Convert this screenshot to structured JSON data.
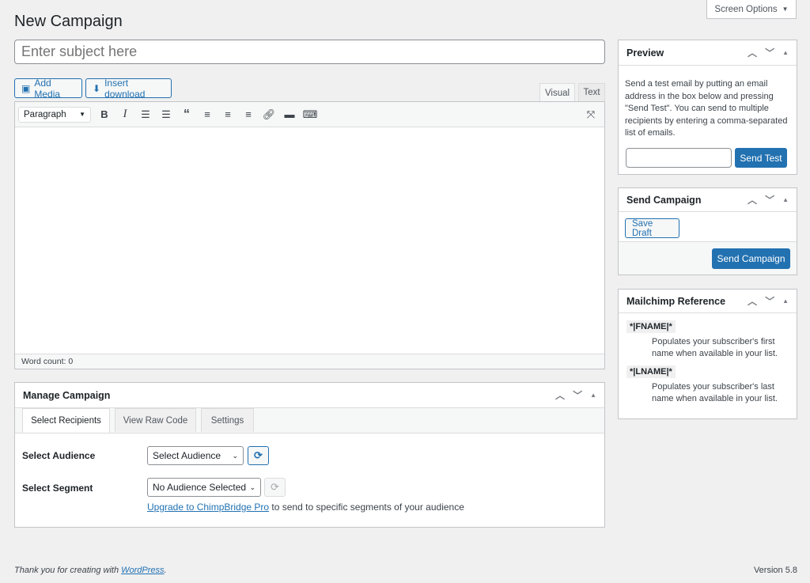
{
  "page": {
    "title": "New Campaign",
    "screen_options": "Screen Options"
  },
  "subject": {
    "placeholder": "Enter subject here",
    "value": ""
  },
  "media": {
    "add_media": "Add Media",
    "insert_download": "Insert download"
  },
  "editor": {
    "tab_visual": "Visual",
    "tab_text": "Text",
    "format": "Paragraph",
    "word_count": "Word count: 0",
    "toolbar": [
      "bold-icon",
      "italic-icon",
      "bullet-list-icon",
      "numbered-list-icon",
      "blockquote-icon",
      "align-left-icon",
      "align-center-icon",
      "align-right-icon",
      "link-icon",
      "read-more-icon",
      "toolbar-toggle-icon",
      "fullscreen-icon"
    ]
  },
  "manage": {
    "title": "Manage Campaign",
    "tabs": [
      "Select Recipients",
      "View Raw Code",
      "Settings"
    ],
    "audience_label": "Select Audience",
    "audience_value": "Select Audience",
    "segment_label": "Select Segment",
    "segment_value": "No Audience Selected",
    "upgrade_link": "Upgrade to ChimpBridge Pro",
    "upgrade_text": " to send to specific segments of your audience"
  },
  "preview": {
    "title": "Preview",
    "description": "Send a test email by putting an email address in the box below and pressing \"Send Test\". You can send to multiple recipients by entering a comma-separated list of emails.",
    "email_value": "",
    "send_test": "Send Test"
  },
  "send_campaign": {
    "title": "Send Campaign",
    "save_draft": "Save Draft",
    "send": "Send Campaign"
  },
  "reference": {
    "title": "Mailchimp Reference",
    "items": [
      {
        "tag": "*|FNAME|*",
        "desc": "Populates your subscriber's first name when available in your list."
      },
      {
        "tag": "*|LNAME|*",
        "desc": "Populates your subscriber's last name when available in your list."
      }
    ]
  },
  "footer": {
    "thanks": "Thank you for creating with ",
    "wp_link": "WordPress",
    "thanks_end": ".",
    "version": "Version 5.8"
  },
  "colors": {
    "accent": "#2271b1",
    "background": "#f0f0f1"
  }
}
